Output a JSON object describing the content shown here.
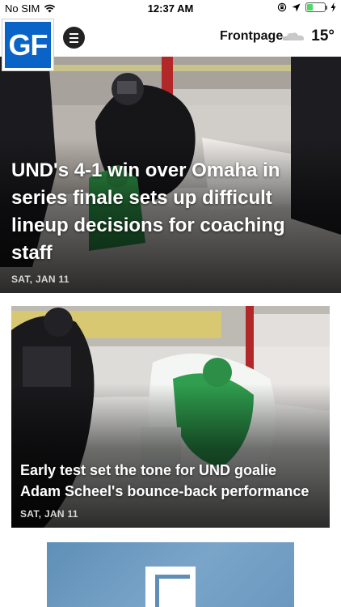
{
  "status_bar": {
    "carrier": "No SIM",
    "time": "12:37 AM",
    "battery_level": 0.35
  },
  "header": {
    "logo_text": "GF",
    "section_title": "Frontpage",
    "temperature": "15°",
    "weather_icon": "cloud-icon"
  },
  "stories": [
    {
      "headline": "UND's 4-1 win over Omaha in series finale sets up difficult lineup decisions for coaching staff",
      "date": "SAT, JAN 11"
    },
    {
      "headline": "Early test set the tone for UND goalie Adam Scheel's bounce-back performance",
      "date": "SAT, JAN 11"
    }
  ],
  "colors": {
    "brand": "#0a63c7",
    "battery": "#4cd964",
    "ad_background": "#6b98c0"
  }
}
